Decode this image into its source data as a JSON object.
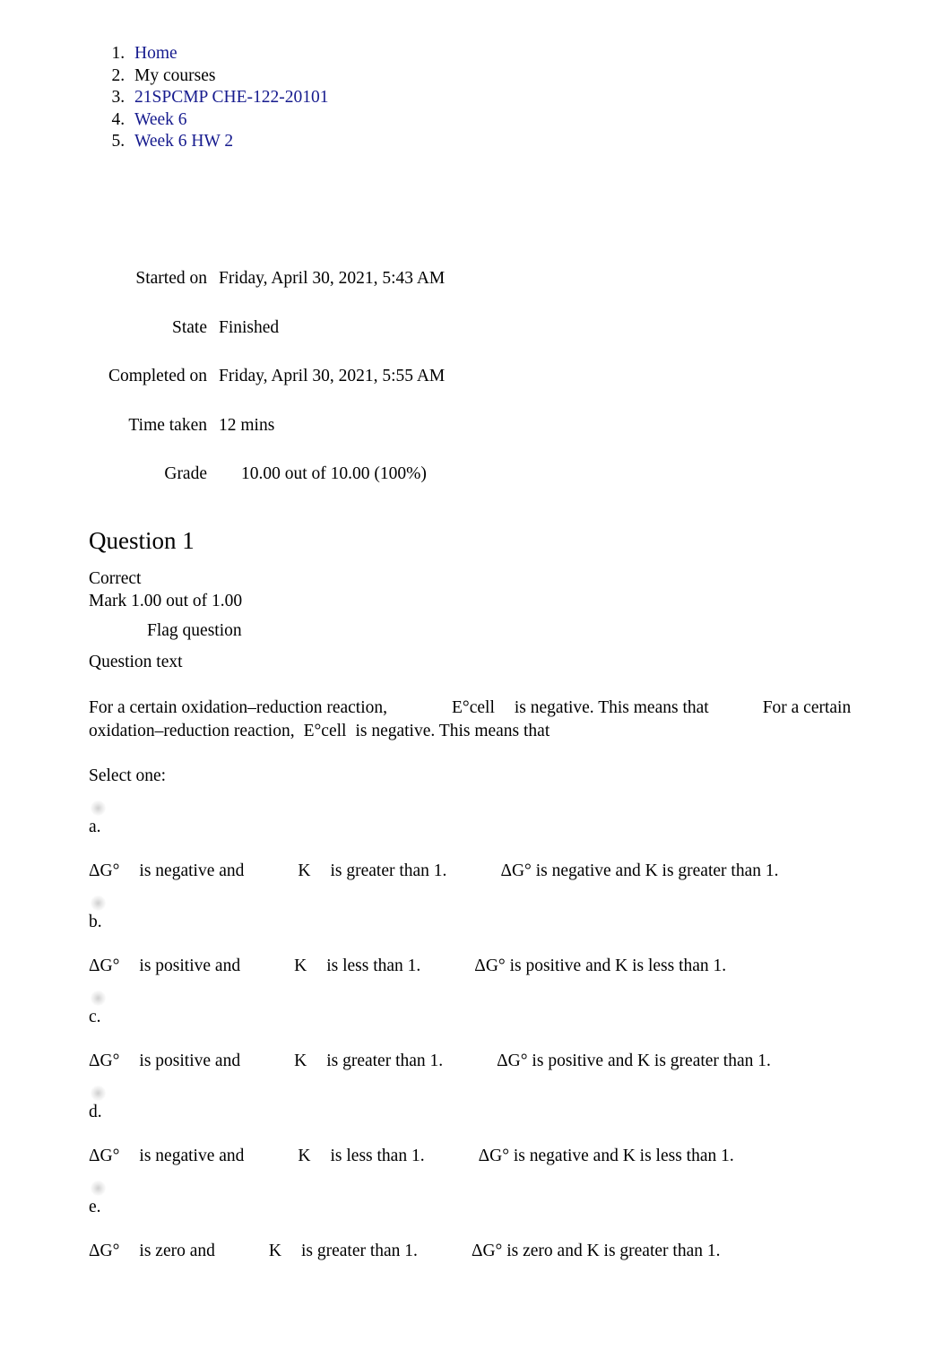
{
  "breadcrumb": {
    "items": [
      {
        "label": "Home",
        "is_link": true
      },
      {
        "label": "My courses",
        "is_link": false
      },
      {
        "label": "21SPCMP CHE-122-20101",
        "is_link": true
      },
      {
        "label": "Week 6",
        "is_link": true
      },
      {
        "label": "Week 6 HW 2",
        "is_link": true
      }
    ]
  },
  "attempt_info": {
    "rows": [
      {
        "label": "Started on",
        "value": "Friday, April 30, 2021, 5:43 AM"
      },
      {
        "label": "State",
        "value": "Finished"
      },
      {
        "label": "Completed on",
        "value": "Friday, April 30, 2021, 5:55 AM"
      },
      {
        "label": "Time taken",
        "value": "12 mins"
      },
      {
        "label": "Grade",
        "value": "10.00 out of 10.00 (100%)"
      }
    ]
  },
  "question": {
    "title": "Question 1",
    "state": "Correct",
    "mark": "Mark 1.00 out of 1.00",
    "flag_label": "Flag question",
    "question_text_label": "Question text",
    "text_part_1": "For a certain oxidation–reduction reaction,",
    "text_part_2": "E°cell",
    "text_part_3": "is negative. This means that",
    "text_part_4": "For a certain oxidation–reduction reaction,",
    "text_part_5": "E°cell",
    "text_part_6": "is negative. This means that",
    "select_one_label": "Select one:",
    "options": [
      {
        "letter": "a.",
        "sym_1": "ΔG°",
        "mid_1": "is negative and",
        "sym_2": "K",
        "mid_2": "is greater than 1.",
        "plain": "ΔG°   is negative and K is greater than 1."
      },
      {
        "letter": "b.",
        "sym_1": "ΔG°",
        "mid_1": "is positive and",
        "sym_2": "K",
        "mid_2": "is less than 1.",
        "plain": "ΔG°   is positive and K is less than 1."
      },
      {
        "letter": "c.",
        "sym_1": "ΔG°",
        "mid_1": "is positive and",
        "sym_2": "K",
        "mid_2": "is greater than 1.",
        "plain": "ΔG°   is positive and K is greater than 1."
      },
      {
        "letter": "d.",
        "sym_1": "ΔG°",
        "mid_1": "is negative and",
        "sym_2": "K",
        "mid_2": "is less than 1.",
        "plain": "ΔG°   is negative and K is less than 1."
      },
      {
        "letter": "e.",
        "sym_1": "ΔG°",
        "mid_1": "is zero and",
        "sym_2": "K",
        "mid_2": "is greater than 1.",
        "plain": "ΔG°   is zero and K is greater than 1."
      }
    ]
  },
  "colors": {
    "link": "#161b8e",
    "text": "#000000",
    "background": "#ffffff"
  }
}
